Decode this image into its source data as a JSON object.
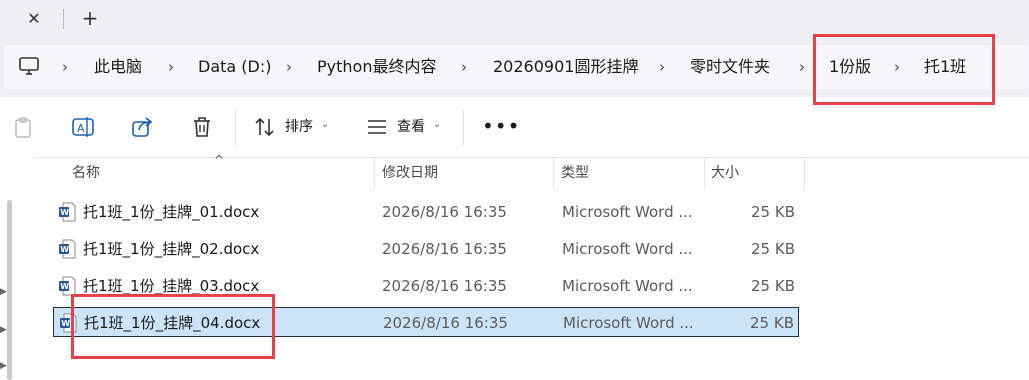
{
  "tabs": {
    "close_glyph": "✕",
    "new_glyph": "+"
  },
  "breadcrumb": {
    "items": [
      "此电脑",
      "Data (D:)",
      "Python最终内容",
      "20260901圆形挂牌",
      "零时文件夹",
      "1份版",
      "托1班"
    ],
    "separator": "›"
  },
  "toolbar": {
    "sort_label": "排序",
    "view_label": "查看",
    "more_label": "•••",
    "caret": "⌄"
  },
  "columns": {
    "name": "名称",
    "date": "修改日期",
    "type": "类型",
    "size": "大小",
    "sort_caret": "^"
  },
  "files": [
    {
      "name": "托1班_1份_挂牌_01.docx",
      "date": "2026/8/16 16:35",
      "type": "Microsoft Word ...",
      "size": "25 KB",
      "selected": false
    },
    {
      "name": "托1班_1份_挂牌_02.docx",
      "date": "2026/8/16 16:35",
      "type": "Microsoft Word ...",
      "size": "25 KB",
      "selected": false
    },
    {
      "name": "托1班_1份_挂牌_03.docx",
      "date": "2026/8/16 16:35",
      "type": "Microsoft Word ...",
      "size": "25 KB",
      "selected": false
    },
    {
      "name": "托1班_1份_挂牌_04.docx",
      "date": "2026/8/16 16:35",
      "type": "Microsoft Word ...",
      "size": "25 KB",
      "selected": true
    }
  ],
  "icons": {
    "computer": "computer-icon",
    "paste": "paste-icon",
    "rename": "rename-icon",
    "share": "share-icon",
    "delete": "delete-icon",
    "sort": "sort-icon",
    "view": "view-icon",
    "word": "word-document-icon"
  },
  "colors": {
    "accent_select": "#cce4f7",
    "annotation": "#e8414b",
    "word_blue": "#2b579a",
    "chrome_bg": "#eef0f4"
  }
}
